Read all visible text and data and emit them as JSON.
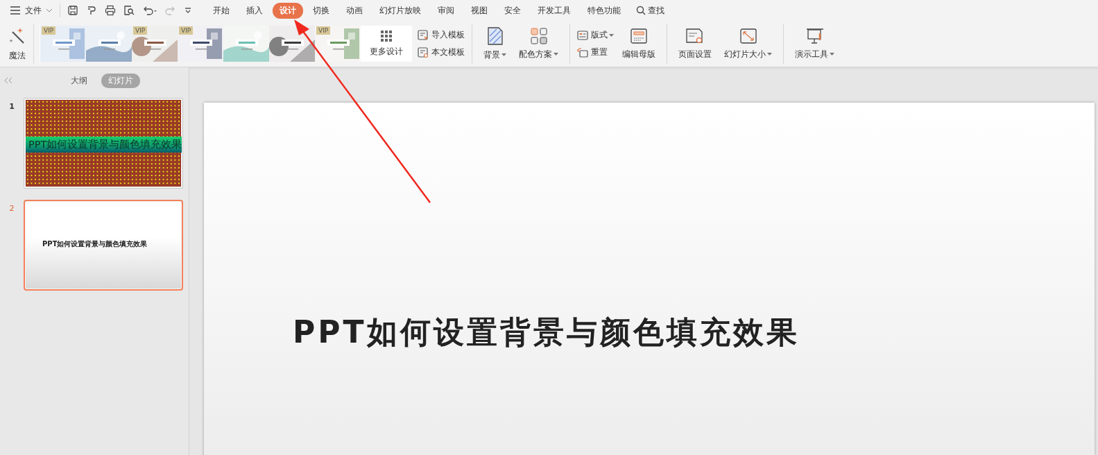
{
  "menu": {
    "label": "文件"
  },
  "tabs": [
    {
      "label": "开始",
      "selected": false
    },
    {
      "label": "插入",
      "selected": false
    },
    {
      "label": "设计",
      "selected": true
    },
    {
      "label": "切换",
      "selected": false
    },
    {
      "label": "动画",
      "selected": false
    },
    {
      "label": "幻灯片放映",
      "selected": false
    },
    {
      "label": "审阅",
      "selected": false
    },
    {
      "label": "视图",
      "selected": false
    },
    {
      "label": "安全",
      "selected": false
    },
    {
      "label": "开发工具",
      "selected": false
    },
    {
      "label": "特色功能",
      "selected": false
    }
  ],
  "search": {
    "label": "查找"
  },
  "ribbon": {
    "magic": {
      "label": "魔法"
    },
    "templates": [
      {
        "kind": "picture",
        "badge": "VIP"
      },
      {
        "kind": "picture"
      },
      {
        "kind": "picture",
        "badge": "VIP"
      },
      {
        "kind": "picture",
        "badge": "VIP"
      },
      {
        "kind": "picture"
      },
      {
        "kind": "picture"
      },
      {
        "kind": "picture",
        "badge": "VIP"
      }
    ],
    "more": {
      "label": "更多设计"
    },
    "groups": [
      {
        "columns": [
          {
            "kind": "stack",
            "items": [
              {
                "label": "导入模板",
                "dropdown": false
              },
              {
                "label": "本文模板",
                "dropdown": false
              }
            ]
          }
        ]
      },
      {
        "columns": [
          {
            "kind": "large",
            "items": [
              {
                "label": "背景",
                "dropdown": true
              }
            ]
          },
          {
            "kind": "large",
            "items": [
              {
                "label": "配色方案",
                "dropdown": true
              }
            ]
          }
        ]
      },
      {
        "columns": [
          {
            "kind": "stack",
            "items": [
              {
                "label": "版式",
                "dropdown": true
              },
              {
                "label": "重置",
                "dropdown": false
              }
            ]
          },
          {
            "kind": "large",
            "items": [
              {
                "label": "编辑母版",
                "dropdown": false
              }
            ]
          }
        ]
      },
      {
        "columns": [
          {
            "kind": "large",
            "items": [
              {
                "label": "页面设置",
                "dropdown": false
              }
            ]
          },
          {
            "kind": "large",
            "items": [
              {
                "label": "幻灯片大小",
                "dropdown": true
              }
            ]
          }
        ]
      },
      {
        "columns": [
          {
            "kind": "large",
            "items": [
              {
                "label": "演示工具",
                "dropdown": true
              }
            ]
          }
        ]
      }
    ]
  },
  "panel_tabs": [
    {
      "label": "大纲",
      "selected": false
    },
    {
      "label": "幻灯片",
      "selected": true
    }
  ],
  "slides": [
    {
      "number": "1",
      "title": "PPT如何设置背景与颜色填充效果",
      "kind": "patterned",
      "selected": false
    },
    {
      "number": "2",
      "title": "PPT如何设置背景与颜色填充效果",
      "kind": "plain",
      "selected": true
    }
  ],
  "slide": {
    "title": "PPT如何设置背景与颜色填充效果"
  }
}
